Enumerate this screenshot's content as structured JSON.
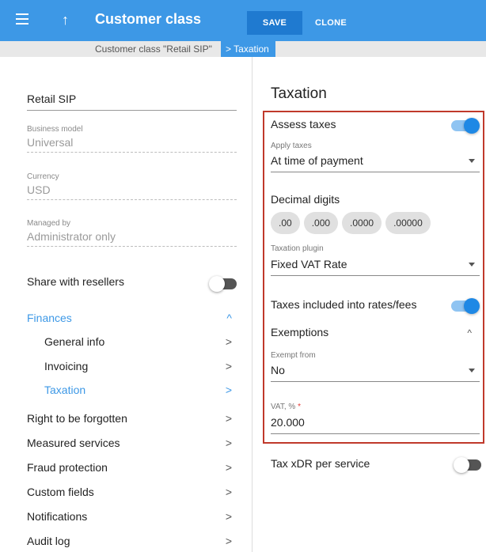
{
  "header": {
    "title": "Customer class",
    "save_label": "SAVE",
    "clone_label": "CLONE"
  },
  "breadcrumb": {
    "parent": "Customer class \"Retail SIP\"",
    "current": "Taxation"
  },
  "left_panel": {
    "name_value": "Retail SIP",
    "business_model": {
      "label": "Business model",
      "value": "Universal"
    },
    "currency": {
      "label": "Currency",
      "value": "USD"
    },
    "managed_by": {
      "label": "Managed by",
      "value": "Administrator only"
    },
    "share_with_resellers": {
      "label": "Share with resellers",
      "enabled": false
    },
    "finances": {
      "label": "Finances",
      "expanded": true,
      "children": [
        {
          "label": "General info",
          "active": false
        },
        {
          "label": "Invoicing",
          "active": false
        },
        {
          "label": "Taxation",
          "active": true
        }
      ]
    },
    "nav_items": [
      {
        "label": "Right to be forgotten"
      },
      {
        "label": "Measured services"
      },
      {
        "label": "Fraud protection"
      },
      {
        "label": "Custom fields"
      },
      {
        "label": "Notifications"
      },
      {
        "label": "Audit log"
      }
    ]
  },
  "taxation": {
    "title": "Taxation",
    "assess_taxes": {
      "label": "Assess taxes",
      "enabled": true
    },
    "apply_taxes": {
      "label": "Apply taxes",
      "value": "At time of payment"
    },
    "decimal_digits": {
      "label": "Decimal digits",
      "options": [
        ".00",
        ".000",
        ".0000",
        ".00000"
      ]
    },
    "taxation_plugin": {
      "label": "Taxation plugin",
      "value": "Fixed VAT Rate"
    },
    "taxes_included": {
      "label": "Taxes included into rates/fees",
      "enabled": true
    },
    "exemptions": {
      "label": "Exemptions",
      "expanded": true
    },
    "exempt_from": {
      "label": "Exempt from",
      "value": "No"
    },
    "vat": {
      "label": "VAT, %",
      "required_mark": "*",
      "value": "20.000"
    },
    "tax_xdr": {
      "label": "Tax xDR per service",
      "enabled": false
    }
  },
  "colors": {
    "accent": "#3d98e6",
    "highlight_border": "#c0392b",
    "toggle_on": "#1e88e5"
  }
}
